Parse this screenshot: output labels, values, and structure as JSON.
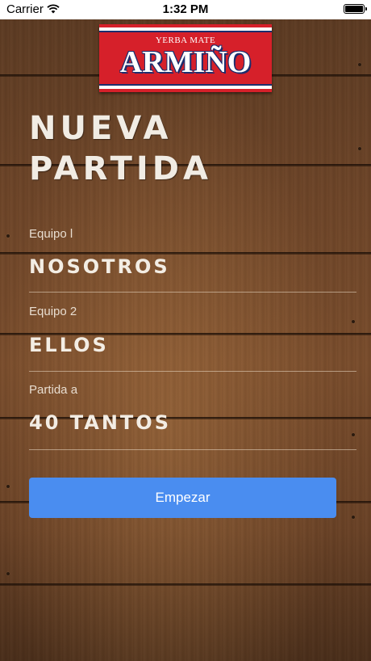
{
  "status_bar": {
    "carrier": "Carrier",
    "time": "1:32 PM",
    "icons": [
      "wifi-icon",
      "battery-icon"
    ]
  },
  "logo": {
    "tagline": "YERBA MATE",
    "brand": "ARMIÑO",
    "colors": {
      "red": "#d6202a",
      "navy": "#1c2e6e",
      "white": "#ffffff"
    }
  },
  "title": {
    "line1": "NUEVA",
    "line2": "PARTIDA"
  },
  "form": {
    "team1": {
      "label": "Equipo l",
      "value": "NOSOTROS"
    },
    "team2": {
      "label": "Equipo 2",
      "value": "ELLOS"
    },
    "match": {
      "label": "Partida a",
      "value": "40 TANTOS"
    }
  },
  "start_button": {
    "label": "Empezar",
    "color": "#4a8df0"
  }
}
